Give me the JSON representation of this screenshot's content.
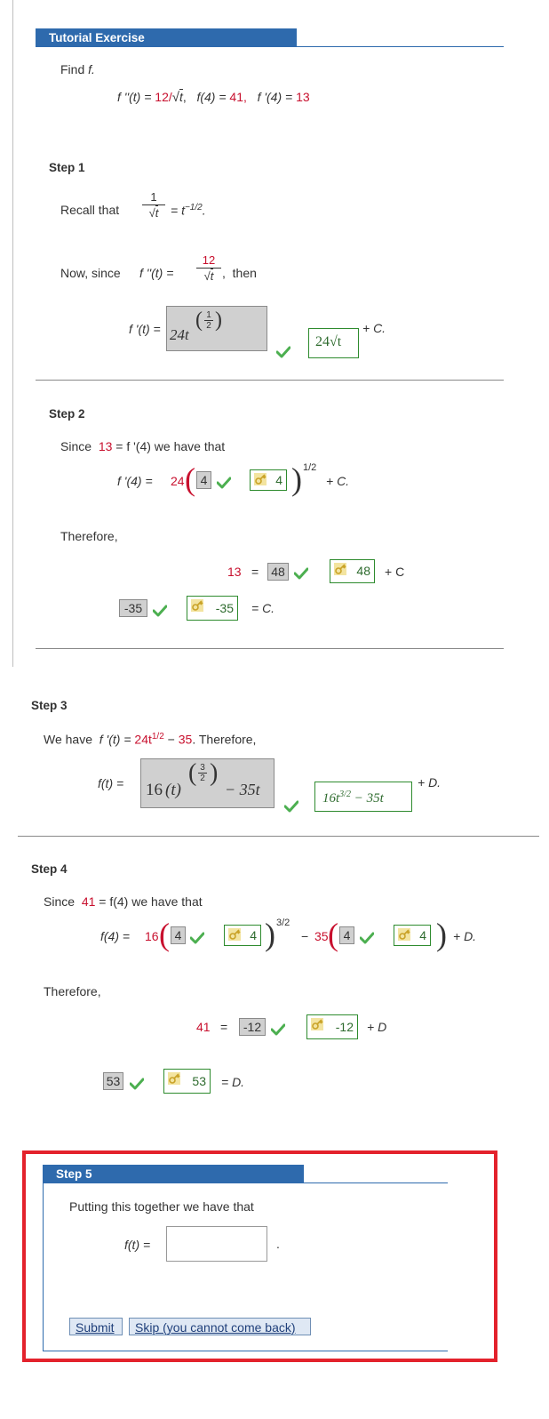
{
  "header": {
    "title": "Tutorial Exercise"
  },
  "problem": {
    "instruction": "Find",
    "fn": "f.",
    "given1_lhs": "f ''(t) =",
    "given1_rhs": "12/",
    "given1_rad": "t",
    "given2": "f(4) = ",
    "given2_val": "41,",
    "given3": "f '(4) = ",
    "given3_val": "13"
  },
  "step1": {
    "title": "Step 1",
    "recall": "Recall that",
    "num": "1",
    "rad": "t",
    "eq": "= t",
    "exp": "−1/2",
    "period": ".",
    "now": "Now, since",
    "fpp": "f ''(t) =",
    "num2": "12",
    "rad2": "t",
    "comma": ",",
    "then": "then",
    "fp": "f '(t) =",
    "entered": "24t",
    "entered_exp_num": "1",
    "entered_exp_den": "2",
    "answer": "24√t",
    "plus": "+ C."
  },
  "step2": {
    "title": "Step 2",
    "since": "Since",
    "v13": "13",
    "rest": "= f '(4)  we have that",
    "fp4": "f '(4) =",
    "coef": "24",
    "entered": "4",
    "answer": "4",
    "exp": "1/2",
    "plus": "+ C.",
    "therefore": "Therefore,",
    "lhs": "13",
    "eq": "=",
    "entered2": "48",
    "answer2": "48",
    "plus2": "+ C",
    "entered3": "-35",
    "answer3": "-35",
    "eqc": "= C."
  },
  "step3": {
    "title": "Step 3",
    "we_have": "We have",
    "fp": "f '(t) =",
    "expr": "24t",
    "expr_exp": "1/2",
    "minus": "−",
    "v35": "35",
    "therefore": ". Therefore,",
    "ft": "f(t) =",
    "entered_coef": "16",
    "entered_t": "(t)",
    "entered_exp_num": "3",
    "entered_exp_den": "2",
    "entered_tail": "− 35t",
    "answer": "16t",
    "answer_exp": "3/2",
    "answer_tail": " − 35t",
    "plus": "+ D."
  },
  "step4": {
    "title": "Step 4",
    "since": "Since",
    "v41": "41",
    "rest": "= f(4)  we have that",
    "f4": "f(4) =",
    "coef1": "16",
    "entered1": "4",
    "answer1": "4",
    "exp": "3/2",
    "minus": "−",
    "coef2": "35",
    "entered2": "4",
    "answer2": "4",
    "plusd": "+ D.",
    "therefore": "Therefore,",
    "lhs": "41",
    "eq": "=",
    "entered3": "-12",
    "answer3": "-12",
    "plus3": "+ D",
    "entered4": "53",
    "answer4": "53",
    "eqd": "= D."
  },
  "step5": {
    "title": "Step 5",
    "text": "Putting this together we have that",
    "ft": "f(t) =",
    "period": ".",
    "input_value": "",
    "submit": "Submit",
    "skip": "Skip (you cannot come back)"
  },
  "colors": {
    "accent": "#2e6aad",
    "red": "#c8102e",
    "green": "#2e8b2e",
    "highlight": "#e3222c"
  }
}
